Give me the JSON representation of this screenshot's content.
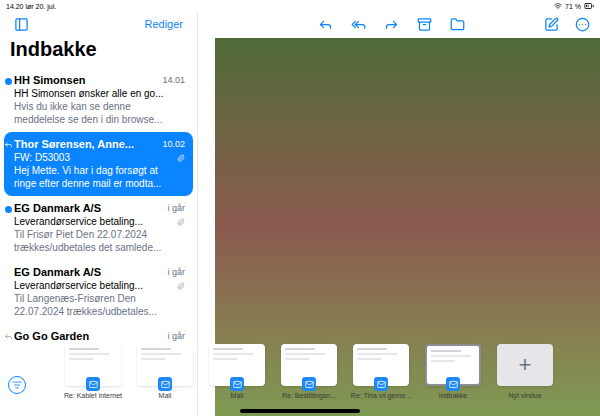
{
  "status_bar": {
    "time": "14.20  lør 20. jul.",
    "battery": "71 %"
  },
  "sidebar": {
    "edit": "Rediger",
    "title": "Indbakke",
    "messages": [
      {
        "sender": "HH Simonsen",
        "time": "14.01",
        "subject": "HH Simonsen ønsker alle en go...",
        "preview": [
          "Hvis du ikke kan se denne",
          "meddelelse se den i din browse..."
        ],
        "unread": true,
        "selected": false,
        "replied": false,
        "attachment": false
      },
      {
        "sender": "Thor Sørensen, Anne...",
        "time": "10.02",
        "subject": "FW: D53003",
        "preview": [
          "Hej Mette. Vi har i dag forsøgt at",
          "ringe efter denne mail er modta..."
        ],
        "unread": false,
        "selected": true,
        "replied": true,
        "attachment": true
      },
      {
        "sender": "EG Danmark A/S",
        "time": "i går",
        "subject": "Leverandørservice betaling...",
        "preview": [
          "Til Frisør Piet Den 22.07.2024",
          "trækkes/udbetales det samlede..."
        ],
        "unread": true,
        "selected": false,
        "replied": false,
        "attachment": true
      },
      {
        "sender": "EG Danmark A/S",
        "time": "i går",
        "subject": "Leverandørservice betaling...",
        "preview": [
          "Til Langenæs-Frisøren Den",
          "22.07.2024 trækkes/udbetales..."
        ],
        "unread": false,
        "selected": false,
        "replied": false,
        "attachment": true
      },
      {
        "sender": "Go Go Garden",
        "time": "i går",
        "subject": "",
        "preview": [],
        "unread": false,
        "selected": false,
        "replied": true,
        "attachment": false
      }
    ]
  },
  "shelf": {
    "windows": [
      {
        "label": "Re: Kablet internet",
        "kind": "mail",
        "selected": false
      },
      {
        "label": "Mail",
        "kind": "mail",
        "selected": false
      },
      {
        "label": "Mail",
        "kind": "mail",
        "selected": false
      },
      {
        "label": "Re: Bestillingsn...",
        "kind": "mail",
        "selected": false
      },
      {
        "label": "Re: Tina vil gerne...",
        "kind": "mail",
        "selected": false
      },
      {
        "label": "Indbakke",
        "kind": "mail",
        "selected": true
      },
      {
        "label": "Nyt vindue",
        "kind": "new",
        "symbol": "+",
        "selected": false
      }
    ]
  }
}
